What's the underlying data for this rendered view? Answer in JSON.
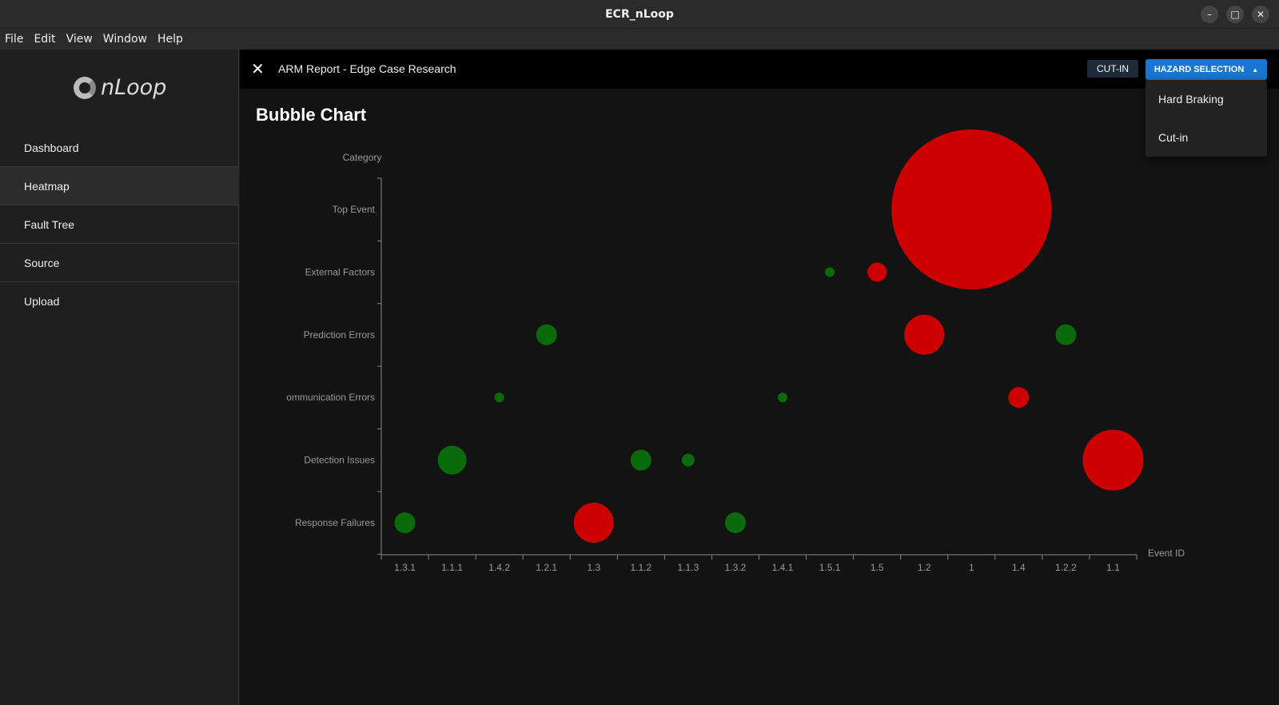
{
  "window": {
    "title": "ECR_nLoop",
    "controls": [
      "–",
      "□",
      "✕"
    ]
  },
  "menu": [
    "File",
    "Edit",
    "View",
    "Window",
    "Help"
  ],
  "logo": {
    "text": "nLoop"
  },
  "nav": [
    {
      "label": "Dashboard",
      "active": false
    },
    {
      "label": "Heatmap",
      "active": true
    },
    {
      "label": "Fault Tree",
      "active": false
    },
    {
      "label": "Source",
      "active": false
    },
    {
      "label": "Upload",
      "active": false
    }
  ],
  "topbar": {
    "close_icon": "close-icon",
    "title": "ARM Report - Edge Case Research",
    "chip": "CUT-IN",
    "hazard_button": "HAZARD SELECTION",
    "hazard_arrow": "▲"
  },
  "dropdown": [
    "Hard Braking",
    "Cut-in"
  ],
  "page": {
    "title": "Bubble Chart"
  },
  "colors": {
    "bad": "#cc0000",
    "good": "#0a6b0a",
    "accent": "#1976d2"
  },
  "chart_data": {
    "type": "scatter",
    "title": "Bubble Chart",
    "xlabel": "Event ID",
    "ylabel": "Category",
    "categories_x": [
      "1.3.1",
      "1.1.1",
      "1.4.2",
      "1.2.1",
      "1.3",
      "1.1.2",
      "1.1.3",
      "1.3.2",
      "1.4.1",
      "1.5.1",
      "1.5",
      "1.2",
      "1",
      "1.4",
      "1.2.2",
      "1.1"
    ],
    "categories_y": [
      "Top Event",
      "External Factors",
      "Prediction Errors",
      "ommunication Errors",
      "Detection Issues",
      "Response Failures"
    ],
    "points": [
      {
        "x": "1",
        "y": "Top Event",
        "size": 100,
        "color": "red"
      },
      {
        "x": "1.5.1",
        "y": "External Factors",
        "size": 6,
        "color": "green"
      },
      {
        "x": "1.5",
        "y": "External Factors",
        "size": 12,
        "color": "red"
      },
      {
        "x": "1.2.1",
        "y": "Prediction Errors",
        "size": 13,
        "color": "green"
      },
      {
        "x": "1.2",
        "y": "Prediction Errors",
        "size": 25,
        "color": "red"
      },
      {
        "x": "1.2.2",
        "y": "Prediction Errors",
        "size": 13,
        "color": "green"
      },
      {
        "x": "1.4.2",
        "y": "ommunication Errors",
        "size": 6,
        "color": "green"
      },
      {
        "x": "1.4.1",
        "y": "ommunication Errors",
        "size": 6,
        "color": "green"
      },
      {
        "x": "1.4",
        "y": "ommunication Errors",
        "size": 13,
        "color": "red"
      },
      {
        "x": "1.1.1",
        "y": "Detection Issues",
        "size": 18,
        "color": "green"
      },
      {
        "x": "1.1.2",
        "y": "Detection Issues",
        "size": 13,
        "color": "green"
      },
      {
        "x": "1.1.3",
        "y": "Detection Issues",
        "size": 8,
        "color": "green"
      },
      {
        "x": "1.1",
        "y": "Detection Issues",
        "size": 38,
        "color": "red"
      },
      {
        "x": "1.3.1",
        "y": "Response Failures",
        "size": 13,
        "color": "green"
      },
      {
        "x": "1.3",
        "y": "Response Failures",
        "size": 25,
        "color": "red"
      },
      {
        "x": "1.3.2",
        "y": "Response Failures",
        "size": 13,
        "color": "green"
      }
    ]
  }
}
